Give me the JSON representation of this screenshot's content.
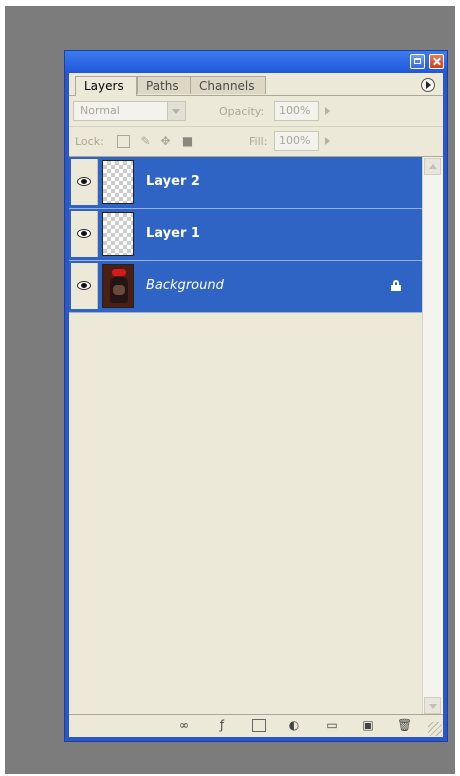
{
  "tabs": {
    "layers": "Layers",
    "paths": "Paths",
    "channels": "Channels"
  },
  "blend_mode": "Normal",
  "opacity": {
    "label": "Opacity:",
    "value": "100%"
  },
  "lock": {
    "label": "Lock:"
  },
  "fill": {
    "label": "Fill:",
    "value": "100%"
  },
  "layers": [
    {
      "name": "Layer 2",
      "visible": true,
      "transparent_thumb": true
    },
    {
      "name": "Layer 1",
      "visible": true,
      "transparent_thumb": true
    },
    {
      "name": "Background",
      "visible": true,
      "locked": true
    }
  ],
  "colors": {
    "selection": "#2f64c5",
    "panel_bg": "#ece9d8",
    "window_border": "#2a56c7"
  },
  "bottom_icons": [
    "link-layers-icon",
    "layer-style-icon",
    "layer-mask-icon",
    "adjustment-layer-icon",
    "new-group-icon",
    "new-layer-icon",
    "delete-layer-icon"
  ]
}
